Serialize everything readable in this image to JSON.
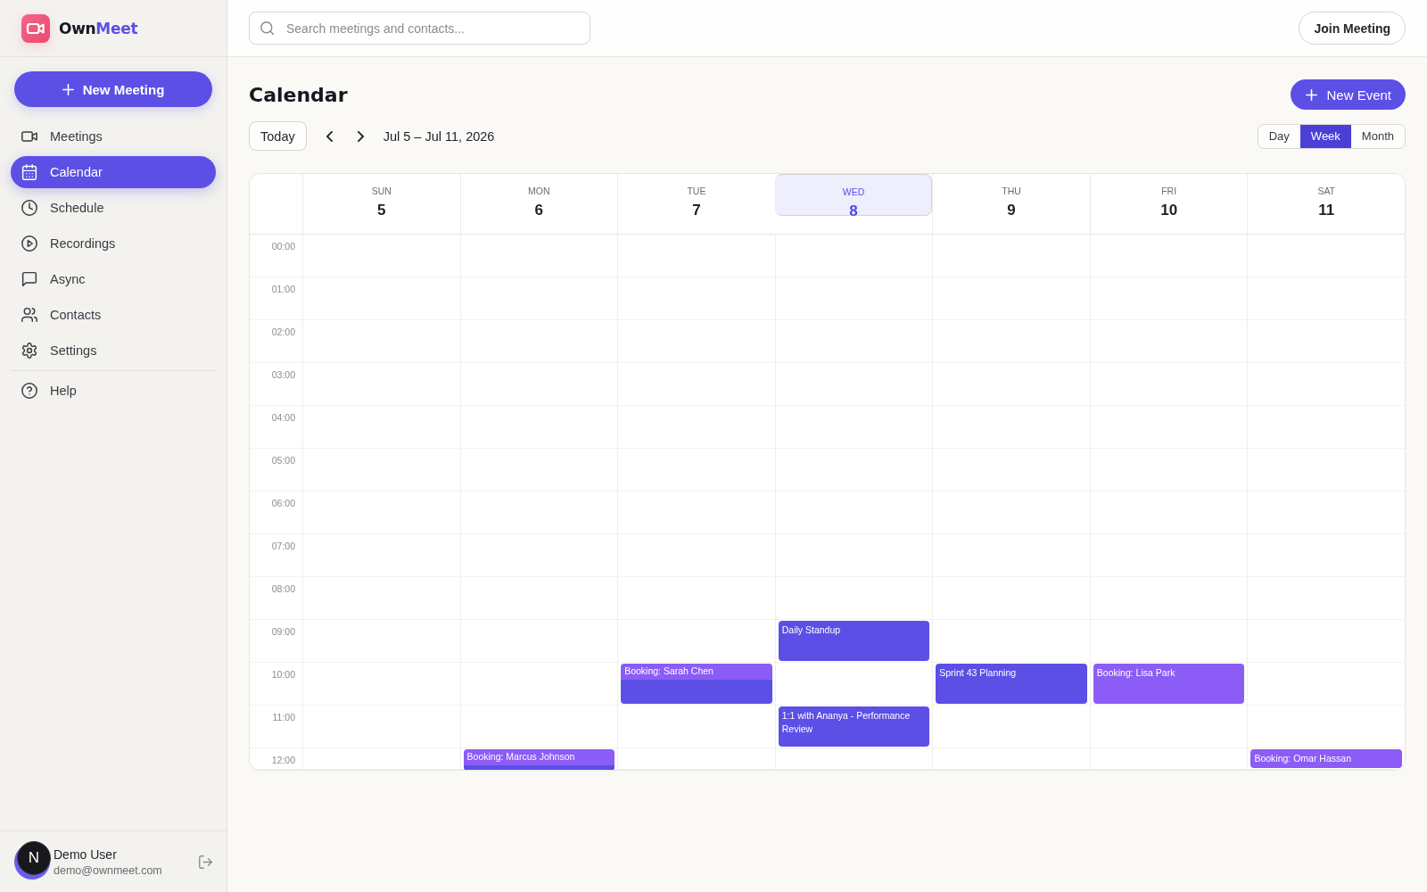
{
  "sidebar": {
    "logo": {
      "parts": [
        {
          "text": "Own",
          "accent": false
        },
        {
          "text": "Meet",
          "accent": true
        }
      ]
    },
    "new_meeting_button": {
      "label": "New Meeting"
    },
    "nav": [
      {
        "label": "Meetings",
        "selected": false
      },
      {
        "label": "Calendar",
        "selected": true
      },
      {
        "label": "Schedule",
        "selected": false
      },
      {
        "label": "Recordings",
        "selected": false
      },
      {
        "label": "Async",
        "selected": false
      },
      {
        "label": "Contacts",
        "selected": false
      },
      {
        "label": "Settings",
        "selected": false
      }
    ],
    "secondary_nav": [
      {
        "label": "Help",
        "selected": false
      }
    ],
    "user": {
      "name": "Demo User",
      "email": "demo@ownmeet.com"
    },
    "dev_indicator": {
      "label": "N"
    }
  },
  "topbar": {
    "search": {
      "placeholder": "Search meetings and contacts..."
    },
    "join_button": {
      "label": "Join Meeting"
    }
  },
  "page": {
    "title": "Calendar",
    "new_event_button": {
      "label": "New Event"
    },
    "today_button": {
      "label": "Today"
    },
    "date_range": "Jul 5 – Jul 11, 2026",
    "views": [
      {
        "label": "Day",
        "selected": false
      },
      {
        "label": "Week",
        "selected": true
      },
      {
        "label": "Month",
        "selected": false
      }
    ]
  },
  "calendar": {
    "days": [
      {
        "weekday": "SUN",
        "date": "5",
        "today": false
      },
      {
        "weekday": "MON",
        "date": "6",
        "today": false
      },
      {
        "weekday": "TUE",
        "date": "7",
        "today": false
      },
      {
        "weekday": "WED",
        "date": "8",
        "today": true
      },
      {
        "weekday": "THU",
        "date": "9",
        "today": false
      },
      {
        "weekday": "FRI",
        "date": "10",
        "today": false
      },
      {
        "weekday": "SAT",
        "date": "11",
        "today": false
      }
    ],
    "rows": [
      {
        "time": "00:00",
        "cells": [
          {},
          {},
          {},
          {},
          {},
          {},
          {}
        ]
      },
      {
        "time": "01:00",
        "cells": [
          {},
          {},
          {},
          {},
          {},
          {},
          {}
        ]
      },
      {
        "time": "02:00",
        "cells": [
          {},
          {},
          {},
          {},
          {},
          {},
          {}
        ]
      },
      {
        "time": "03:00",
        "cells": [
          {},
          {},
          {},
          {},
          {},
          {},
          {}
        ]
      },
      {
        "time": "04:00",
        "cells": [
          {},
          {},
          {},
          {},
          {},
          {},
          {}
        ]
      },
      {
        "time": "05:00",
        "cells": [
          {},
          {},
          {},
          {},
          {},
          {},
          {}
        ]
      },
      {
        "time": "06:00",
        "cells": [
          {},
          {},
          {},
          {},
          {},
          {},
          {}
        ]
      },
      {
        "time": "07:00",
        "cells": [
          {},
          {},
          {},
          {},
          {},
          {},
          {}
        ]
      },
      {
        "time": "08:00",
        "cells": [
          {},
          {},
          {},
          {},
          {},
          {},
          {}
        ]
      },
      {
        "time": "09:00",
        "cells": [
          {},
          {},
          {},
          {
            "events": [
              {
                "kind": "block",
                "title": "Daily Standup",
                "color": "#5b4fe6"
              }
            ]
          },
          {},
          {},
          {}
        ]
      },
      {
        "time": "10:00",
        "cells": [
          {},
          {},
          {
            "events": [
              {
                "kind": "strip",
                "title": "Booking: Sarah Chen",
                "color": "#8b5cf6"
              },
              {
                "kind": "block",
                "color": "#5b4fe6"
              }
            ]
          },
          {},
          {
            "events": [
              {
                "kind": "block",
                "title": "Sprint 43 Planning",
                "color": "#5b4fe6"
              }
            ]
          },
          {
            "events": [
              {
                "kind": "block",
                "title": "Booking: Lisa Park",
                "color": "#8b5cf6"
              }
            ]
          },
          {}
        ]
      },
      {
        "time": "11:00",
        "cells": [
          {},
          {},
          {},
          {
            "events": [
              {
                "kind": "block",
                "title": "1:1 with Ananya - Performance Review",
                "color": "#5b4fe6"
              }
            ]
          },
          {},
          {},
          {}
        ]
      },
      {
        "time": "12:00",
        "cells": [
          {},
          {
            "events": [
              {
                "kind": "strip",
                "title": "Booking: Marcus Johnson",
                "color": "#8b5cf6"
              },
              {
                "kind": "block",
                "color": "#5b4fe6"
              }
            ]
          },
          {},
          {},
          {},
          {},
          {
            "events": [
              {
                "kind": "block",
                "title": "Booking: Omar Hassan",
                "color": "#8b5cf6"
              }
            ]
          }
        ]
      }
    ]
  }
}
